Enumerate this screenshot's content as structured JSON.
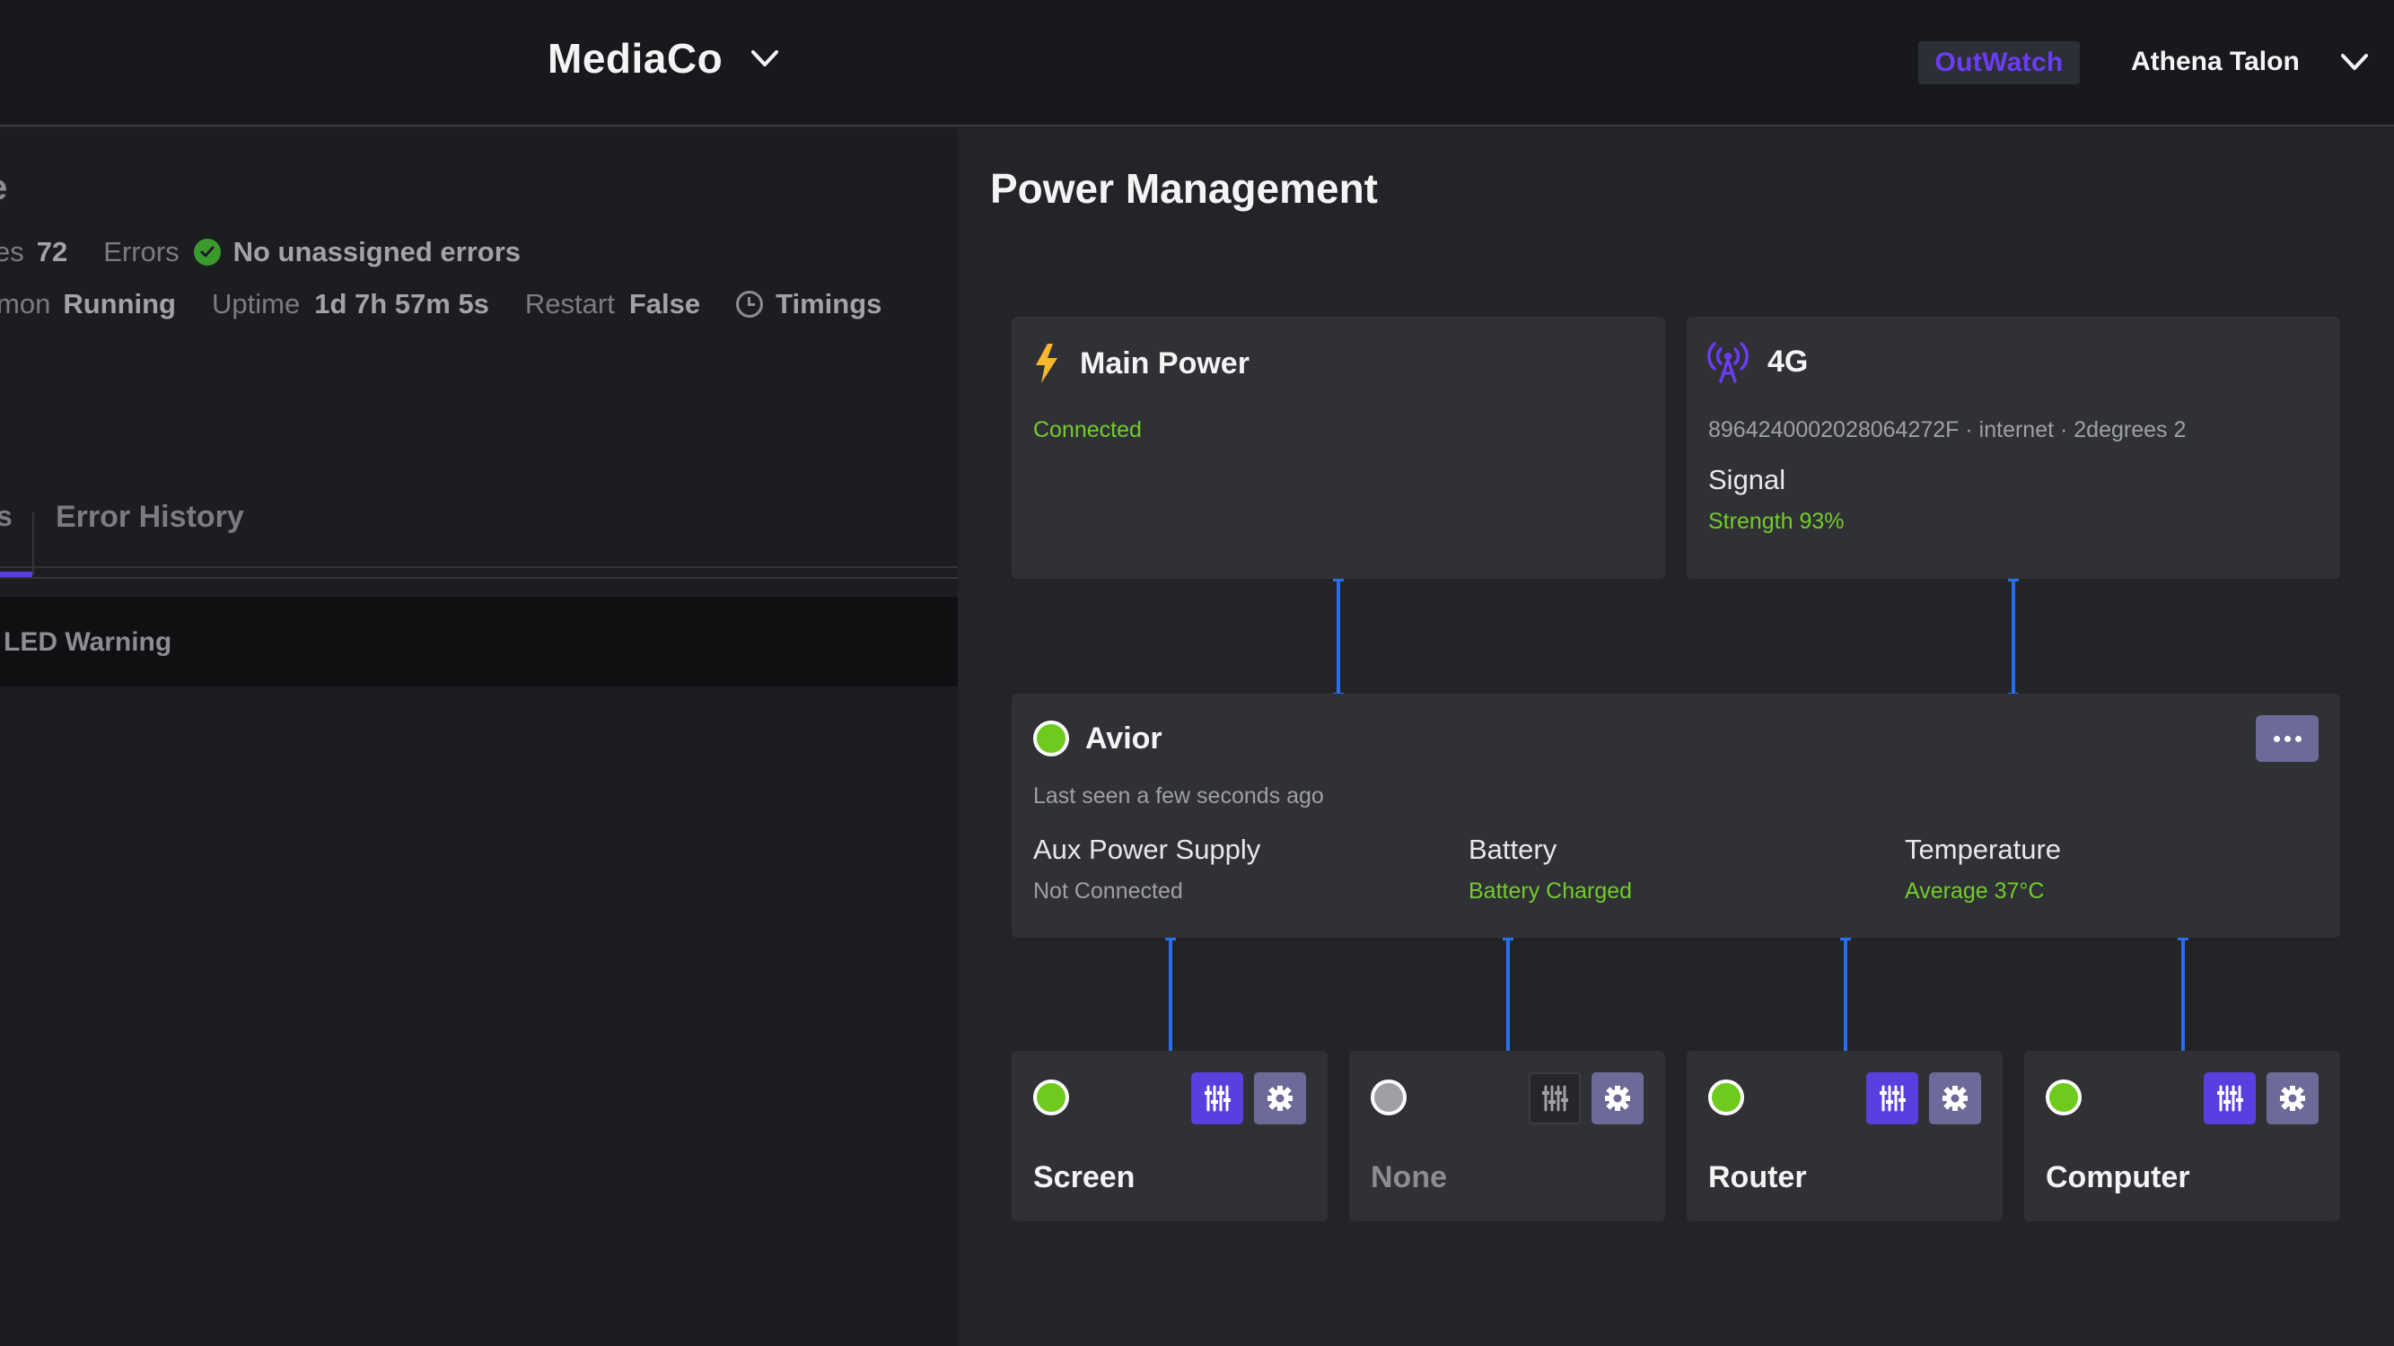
{
  "header": {
    "org_name": "MediaCo",
    "logo_text": "OutWatch",
    "user_name": "Athena Talon"
  },
  "left_pane": {
    "title_fragment": "e",
    "stats": {
      "frag1_label": "es",
      "frag1_value": "72",
      "errors_label": "Errors",
      "errors_value": "No unassigned errors",
      "frag2_label": "mon",
      "frag2_value": "Running",
      "uptime_label": "Uptime",
      "uptime_value": "1d 7h 57m 5s",
      "restart_label": "Restart",
      "restart_value": "False",
      "timings_label": "Timings"
    },
    "tabs": {
      "fragment": "s",
      "error_history": "Error History"
    },
    "led_row": "LED Warning"
  },
  "power": {
    "title": "Power Management",
    "main_power": {
      "title": "Main Power",
      "status": "Connected"
    },
    "cellular": {
      "title": "4G",
      "details": "8964240002028064272F · internet · 2degrees 2",
      "signal_label": "Signal",
      "signal_value": "Strength 93%"
    },
    "avior": {
      "name": "Avior",
      "last_seen": "Last seen a few seconds ago",
      "aux_label": "Aux Power Supply",
      "aux_value": "Not Connected",
      "battery_label": "Battery",
      "battery_value": "Battery Charged",
      "temp_label": "Temperature",
      "temp_value": "Average 37°C"
    },
    "devices": [
      {
        "name": "Screen",
        "status": "on"
      },
      {
        "name": "None",
        "status": "off"
      },
      {
        "name": "Router",
        "status": "on"
      },
      {
        "name": "Computer",
        "status": "on"
      }
    ]
  },
  "colors": {
    "accent": "#5b3ee0",
    "status_green": "#74cb2c",
    "connector_blue": "#2a6ef0",
    "lightning_yellow": "#f5b82e",
    "antenna_purple": "#6b3cf5"
  }
}
